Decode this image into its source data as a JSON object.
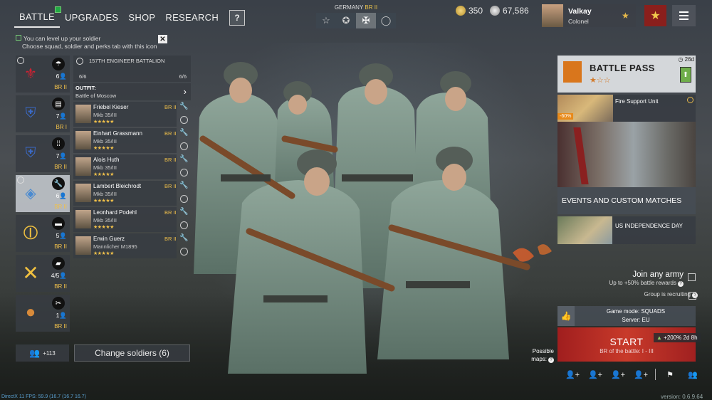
{
  "nav": {
    "tabs": [
      "BATTLE",
      "UPGRADES",
      "SHOP",
      "RESEARCH"
    ],
    "help": "?"
  },
  "hint": {
    "line1": "You can level up your soldier",
    "line2": "Choose squad, soldier and perks tab with this icon",
    "close": "✕"
  },
  "nation": {
    "name": "GERMANY",
    "br": "BR II"
  },
  "currency": {
    "silver_gold": "350",
    "silver": "67,586"
  },
  "profile": {
    "name": "Valkay",
    "rank": "Colonel"
  },
  "squads": [
    {
      "count": "6",
      "br": "BR II"
    },
    {
      "count": "7",
      "br": "BR I"
    },
    {
      "count": "7",
      "br": "BR II"
    },
    {
      "count": "6",
      "br": "BR II"
    },
    {
      "count": "5",
      "br": "BR II"
    },
    {
      "count": "4/5",
      "br": "BR II"
    },
    {
      "count": "1",
      "br": "BR II"
    }
  ],
  "squad_detail": {
    "title": "157TH ENGINEER BATTALION",
    "count_left": "6/6",
    "count_right": "6/6",
    "outfit_label": "OUTFIT:",
    "outfit_value": "Battle of Moscow"
  },
  "soldiers": [
    {
      "name": "Friebel Kieser",
      "weapon": "Mkb 35/III",
      "br": "BR II",
      "stars": "★★★★★"
    },
    {
      "name": "Einhart Grassmann",
      "weapon": "Mkb 35/III",
      "br": "BR II",
      "stars": "★★★★★"
    },
    {
      "name": "Alois Huth",
      "weapon": "Mkb 35/III",
      "br": "BR II",
      "stars": "★★★★★"
    },
    {
      "name": "Lambert Bleichrodt",
      "weapon": "Mkb 35/III",
      "br": "BR II",
      "stars": "★★★★★"
    },
    {
      "name": "Leonhard Podehl",
      "weapon": "Mkb 35/III",
      "br": "BR II",
      "stars": "★★★★★"
    },
    {
      "name": "Erwin Guerz",
      "weapon": "Mannlicher M1895",
      "br": "BR II",
      "stars": "★★★★★"
    }
  ],
  "reserve": {
    "count": "+113"
  },
  "change_soldiers": "Change soldiers (6)",
  "battle_pass": {
    "title": "BATTLE PASS",
    "days": "26d",
    "stars": "★☆☆"
  },
  "offer": {
    "title": "Fire Support Unit",
    "discount": "-60%"
  },
  "events": {
    "title": "EVENTS AND CUSTOM MATCHES",
    "item": "US INDEPENDENCE DAY"
  },
  "join": {
    "title": "Join any army",
    "sub": "Up to +50% battle rewards",
    "recruit": "Group is recruiting"
  },
  "mode": {
    "line1": "Game mode: SQUADS",
    "line2": "Server: EU"
  },
  "start": {
    "label": "START",
    "sub": "BR of the battle: I - III",
    "bonus": "+200% 2d 8h"
  },
  "maps": {
    "line1": "Possible",
    "line2": "maps:"
  },
  "fps": "DirectX 11 FPS: 59.9 (16.7 (16.7 16.7)",
  "version": "version: 0.6.9.64",
  "colors": {
    "accent": "#e8c14a",
    "start": "#c83a2a",
    "br": "#f0c04a"
  }
}
